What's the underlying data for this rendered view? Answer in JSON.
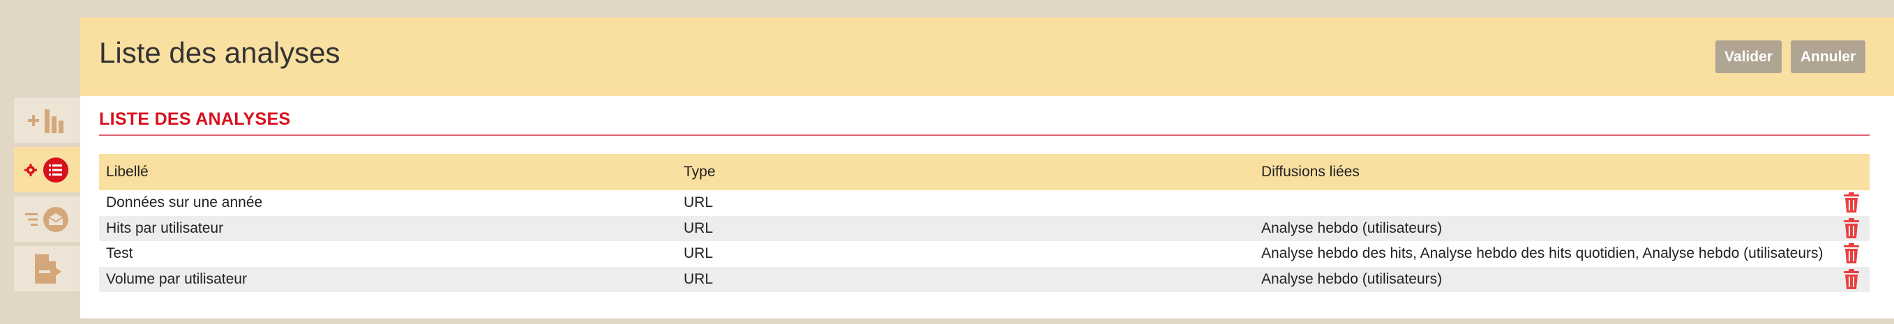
{
  "header": {
    "title": "Liste des analyses",
    "validate_label": "Valider",
    "cancel_label": "Annuler"
  },
  "section": {
    "title": "LISTE DES ANALYSES"
  },
  "table": {
    "columns": [
      "Libellé",
      "Type",
      "Diffusions liées"
    ],
    "rows": [
      {
        "label": "Données sur une année",
        "type": "URL",
        "diffusions": ""
      },
      {
        "label": "Hits par utilisateur",
        "type": "URL",
        "diffusions": "Analyse hebdo (utilisateurs)"
      },
      {
        "label": "Test",
        "type": "URL",
        "diffusions": "Analyse hebdo des hits, Analyse hebdo des hits quotidien, Analyse hebdo (utilisateurs)"
      },
      {
        "label": "Volume par utilisateur",
        "type": "URL",
        "diffusions": "Analyse hebdo (utilisateurs)"
      }
    ]
  },
  "toolbar": {
    "items": [
      {
        "icon": "add-chart-icon",
        "active": false
      },
      {
        "icon": "settings-list-icon",
        "active": true
      },
      {
        "icon": "mail-list-icon",
        "active": false
      },
      {
        "icon": "document-export-icon",
        "active": false
      }
    ]
  },
  "colors": {
    "accent": "#d8101c",
    "header_bg": "#f9dfa0",
    "button_bg": "#b0a492",
    "icon_tan": "#d4a77a",
    "delete_red": "#e84040"
  }
}
